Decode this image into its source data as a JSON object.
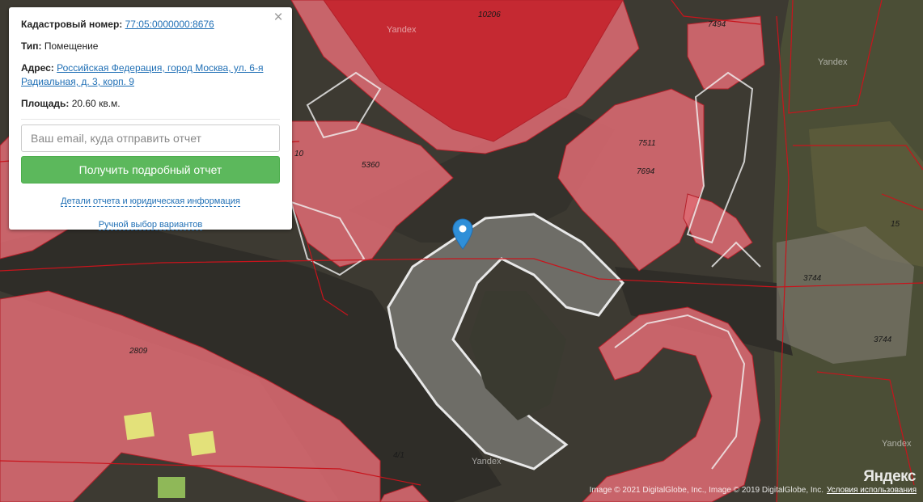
{
  "popup": {
    "cadastral_label": "Кадастровый номер:",
    "cadastral_value": "77:05:0000000:8676",
    "type_label": "Тип:",
    "type_value": "Помещение",
    "address_label": "Адрес:",
    "address_value": "Российская Федерация, город Москва, ул. 6-я Радиальная, д. 3, корп. 9",
    "area_label": "Площадь:",
    "area_value": "20.60 кв.м.",
    "email_placeholder": "Ваш email, куда отправить отчет",
    "email_value": "",
    "report_button": "Получить подробный отчет",
    "details_link": "Детали отчета и юридическая информация",
    "manual_link": "Ручной выбор вариантов",
    "close_glyph": "×"
  },
  "map": {
    "parcel_labels": [
      "10206",
      "7494",
      "7511",
      "7694",
      "5360",
      "10",
      "15",
      "3744",
      "3744",
      "2809",
      "4/1"
    ],
    "watermarks": [
      "Yandex",
      "Yandex",
      "Yandex",
      "Yandex"
    ],
    "logo": "Яндекс",
    "copyright": "Image © 2021 DigitalGlobe, Inc., Image © 2019 DigitalGlobe, Inc.",
    "terms_link": "Условия использования",
    "colors": {
      "parcel_fill": "#e06b73",
      "parcel_border": "#b4202a",
      "boundary": "#c8141c",
      "imagery": "#3e3b33",
      "marker": "#2f8fd8"
    }
  }
}
